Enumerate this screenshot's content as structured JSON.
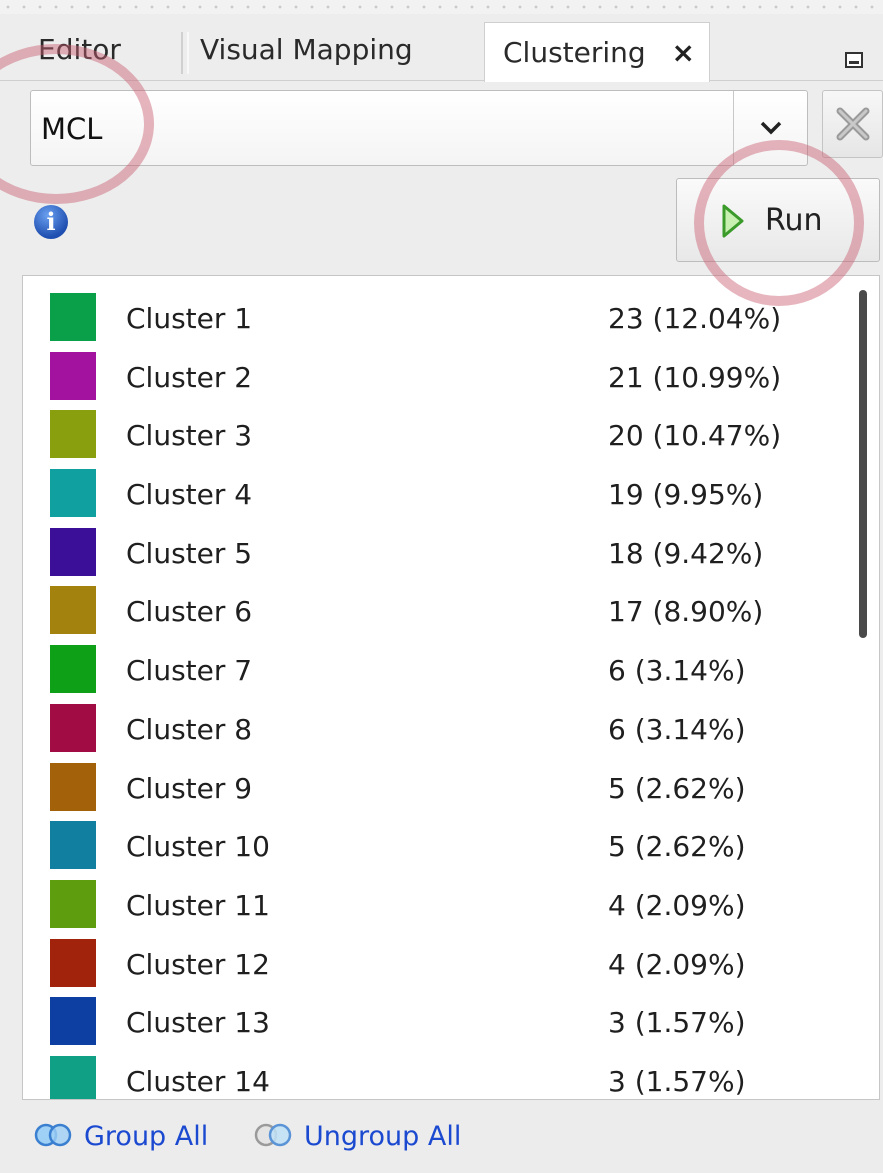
{
  "tabs": [
    {
      "label": "Editor",
      "active": false
    },
    {
      "label": "Visual Mapping",
      "active": false
    },
    {
      "label": "Clustering",
      "active": true,
      "close_icon": "×"
    }
  ],
  "window_controls": {
    "minimize_icon": "minimize-icon"
  },
  "algorithm_select": {
    "value": "MCL",
    "dropdown_icon": "chevron-down-icon"
  },
  "cancel_button": {
    "icon": "cancel-icon"
  },
  "info": {
    "icon": "info-icon",
    "glyph": "i"
  },
  "run_button": {
    "label": "Run",
    "icon": "play-icon"
  },
  "clusters": [
    {
      "name": "Cluster 1",
      "count": "23 (12.04%)",
      "color": "#0aa04a"
    },
    {
      "name": "Cluster 2",
      "count": "21 (10.99%)",
      "color": "#a3119f"
    },
    {
      "name": "Cluster 3",
      "count": "20 (10.47%)",
      "color": "#8a9f0d"
    },
    {
      "name": "Cluster 4",
      "count": "19 (9.95%)",
      "color": "#10a0a0"
    },
    {
      "name": "Cluster 5",
      "count": "18 (9.42%)",
      "color": "#3c0f99"
    },
    {
      "name": "Cluster 6",
      "count": "17 (8.90%)",
      "color": "#a3830d"
    },
    {
      "name": "Cluster 7",
      "count": "6 (3.14%)",
      "color": "#0ea117"
    },
    {
      "name": "Cluster 8",
      "count": "6 (3.14%)",
      "color": "#a10c45"
    },
    {
      "name": "Cluster 9",
      "count": "5 (2.62%)",
      "color": "#a3620a"
    },
    {
      "name": "Cluster 10",
      "count": "5 (2.62%)",
      "color": "#107fa0"
    },
    {
      "name": "Cluster 11",
      "count": "4 (2.09%)",
      "color": "#5e9e0e"
    },
    {
      "name": "Cluster 12",
      "count": "4 (2.09%)",
      "color": "#a1230c"
    },
    {
      "name": "Cluster 13",
      "count": "3 (1.57%)",
      "color": "#0d3ea1"
    },
    {
      "name": "Cluster 14",
      "count": "3 (1.57%)",
      "color": "#0fa085"
    }
  ],
  "footer": {
    "group_all": {
      "label": "Group All",
      "icon": "group-icon"
    },
    "ungroup_all": {
      "label": "Ungroup All",
      "icon": "ungroup-icon"
    }
  },
  "colors": {
    "accent_link": "#1b4ad1",
    "highlight": "#c85a6e"
  }
}
